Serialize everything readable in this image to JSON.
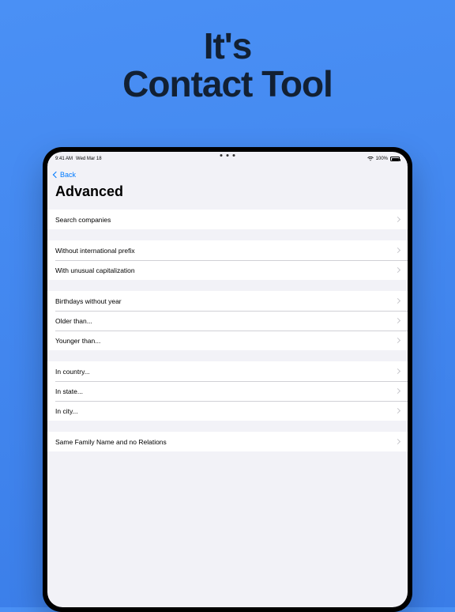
{
  "hero": {
    "line1": "It's",
    "line2": "Contact Tool"
  },
  "status": {
    "time": "9:41 AM",
    "date": "Wed Mar 18",
    "battery": "100%"
  },
  "nav": {
    "back": "Back",
    "title": "Advanced"
  },
  "groups": [
    [
      {
        "label": "Search companies"
      }
    ],
    [
      {
        "label": "Without international prefix"
      },
      {
        "label": "With unusual capitalization"
      }
    ],
    [
      {
        "label": "Birthdays without year"
      },
      {
        "label": "Older than..."
      },
      {
        "label": "Younger than..."
      }
    ],
    [
      {
        "label": "In country..."
      },
      {
        "label": "In state..."
      },
      {
        "label": "In city..."
      }
    ],
    [
      {
        "label": "Same Family Name and no Relations"
      }
    ]
  ]
}
